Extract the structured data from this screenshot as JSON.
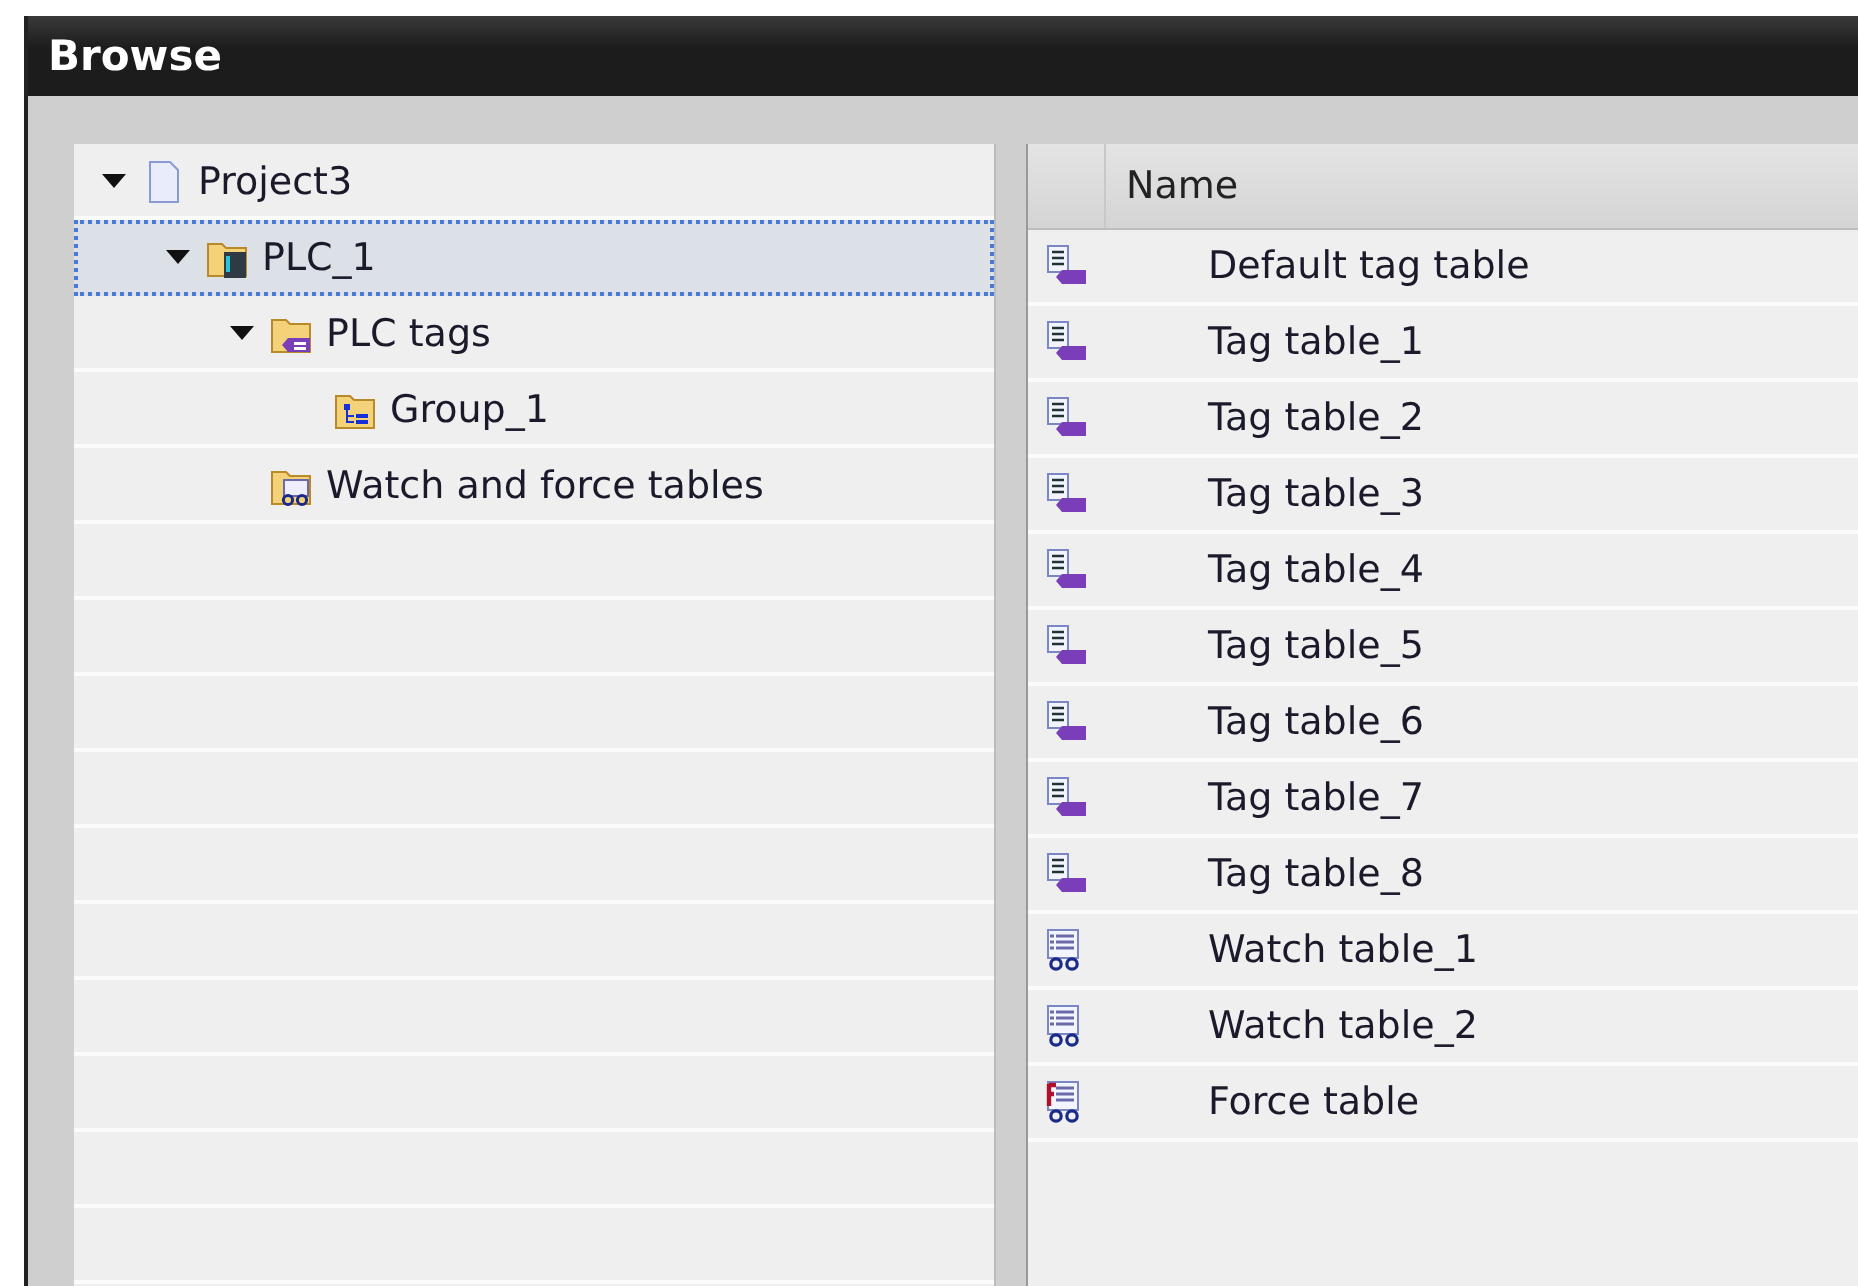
{
  "window": {
    "title": "Browse"
  },
  "tree": [
    {
      "label": "Project3",
      "kind": "project",
      "expanded": true,
      "selected": false,
      "children": [
        {
          "label": "PLC_1",
          "kind": "plc",
          "expanded": true,
          "selected": true,
          "children": [
            {
              "label": "PLC tags",
              "kind": "tag-folder",
              "expanded": true,
              "selected": false,
              "children": [
                {
                  "label": "Group_1",
                  "kind": "group",
                  "expanded": false,
                  "selected": false
                }
              ]
            },
            {
              "label": "Watch and force tables",
              "kind": "watch-folder",
              "expanded": false,
              "selected": false
            }
          ]
        }
      ]
    }
  ],
  "table": {
    "columns": [
      "Name"
    ],
    "rows": [
      {
        "name": "Default tag table",
        "kind": "tag-table"
      },
      {
        "name": "Tag table_1",
        "kind": "tag-table"
      },
      {
        "name": "Tag table_2",
        "kind": "tag-table"
      },
      {
        "name": "Tag table_3",
        "kind": "tag-table"
      },
      {
        "name": "Tag table_4",
        "kind": "tag-table"
      },
      {
        "name": "Tag table_5",
        "kind": "tag-table"
      },
      {
        "name": "Tag table_6",
        "kind": "tag-table"
      },
      {
        "name": "Tag table_7",
        "kind": "tag-table"
      },
      {
        "name": "Tag table_8",
        "kind": "tag-table"
      },
      {
        "name": "Watch table_1",
        "kind": "watch-table"
      },
      {
        "name": "Watch table_2",
        "kind": "watch-table"
      },
      {
        "name": "Force table",
        "kind": "force-table"
      }
    ]
  }
}
